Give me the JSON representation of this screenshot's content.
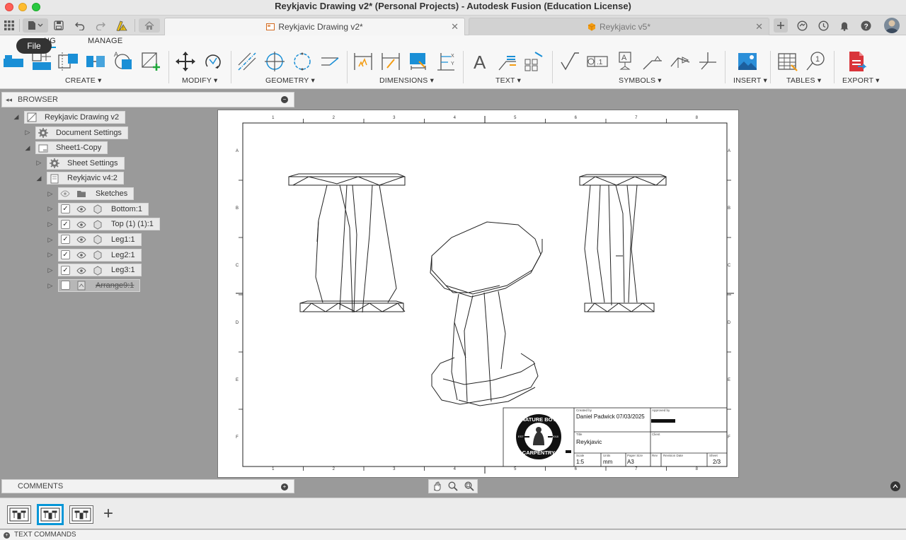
{
  "window": {
    "title": "Reykjavic Drawing v2* (Personal Projects) - Autodesk Fusion (Education License)"
  },
  "tabs": [
    {
      "label": "Reykjavic Drawing v2*",
      "active": true
    },
    {
      "label": "Reykjavic v5*",
      "active": false
    }
  ],
  "ribbon": {
    "file_tooltip": "File",
    "tabs": [
      "NG",
      "MANAGE"
    ],
    "groups": [
      "CREATE",
      "MODIFY",
      "GEOMETRY",
      "DIMENSIONS",
      "TEXT",
      "SYMBOLS",
      "INSERT",
      "TABLES",
      "EXPORT"
    ],
    "dropdown_glyph": "▾",
    "accent": "#0696d7"
  },
  "browser": {
    "title": "BROWSER",
    "items": [
      {
        "label": "Reykjavic Drawing v2"
      },
      {
        "label": "Document Settings"
      },
      {
        "label": "Sheet1-Copy"
      },
      {
        "label": "Sheet Settings"
      },
      {
        "label": "Reykjavic v4:2"
      },
      {
        "label": "Sketches"
      },
      {
        "label": "Bottom:1"
      },
      {
        "label": "Top (1) (1):1"
      },
      {
        "label": "Leg1:1"
      },
      {
        "label": "Leg2:1"
      },
      {
        "label": "Leg3:1"
      },
      {
        "label": "Arrange9:1"
      }
    ]
  },
  "sheet": {
    "border_cols": [
      "1",
      "2",
      "3",
      "4",
      "5",
      "6",
      "7",
      "8"
    ],
    "border_rows": [
      "A",
      "B",
      "C",
      "D",
      "E",
      "F"
    ],
    "title_block": {
      "logo_top": "NATURE BOY",
      "logo_bottom": "CARPENTRY",
      "logo_est": "EST",
      "logo_year": "2018",
      "created_by_label": "Created by",
      "created_by": "Daniel Padwick",
      "date": "07/03/2025",
      "approved_by_label": "Approved by",
      "title_label": "Title",
      "title": "Reykjavic",
      "client_label": "Client",
      "scale_label": "Scale",
      "scale": "1:5",
      "units_label": "Units",
      "units": "mm",
      "paper_label": "Paper Size",
      "paper": "A3",
      "rev_label": "Rev",
      "revdate_label": "Revision Date",
      "sheet_label": "Sheet",
      "sheet": "2/3"
    }
  },
  "comments": {
    "label": "COMMENTS"
  },
  "text_commands": {
    "label": "TEXT COMMANDS"
  }
}
